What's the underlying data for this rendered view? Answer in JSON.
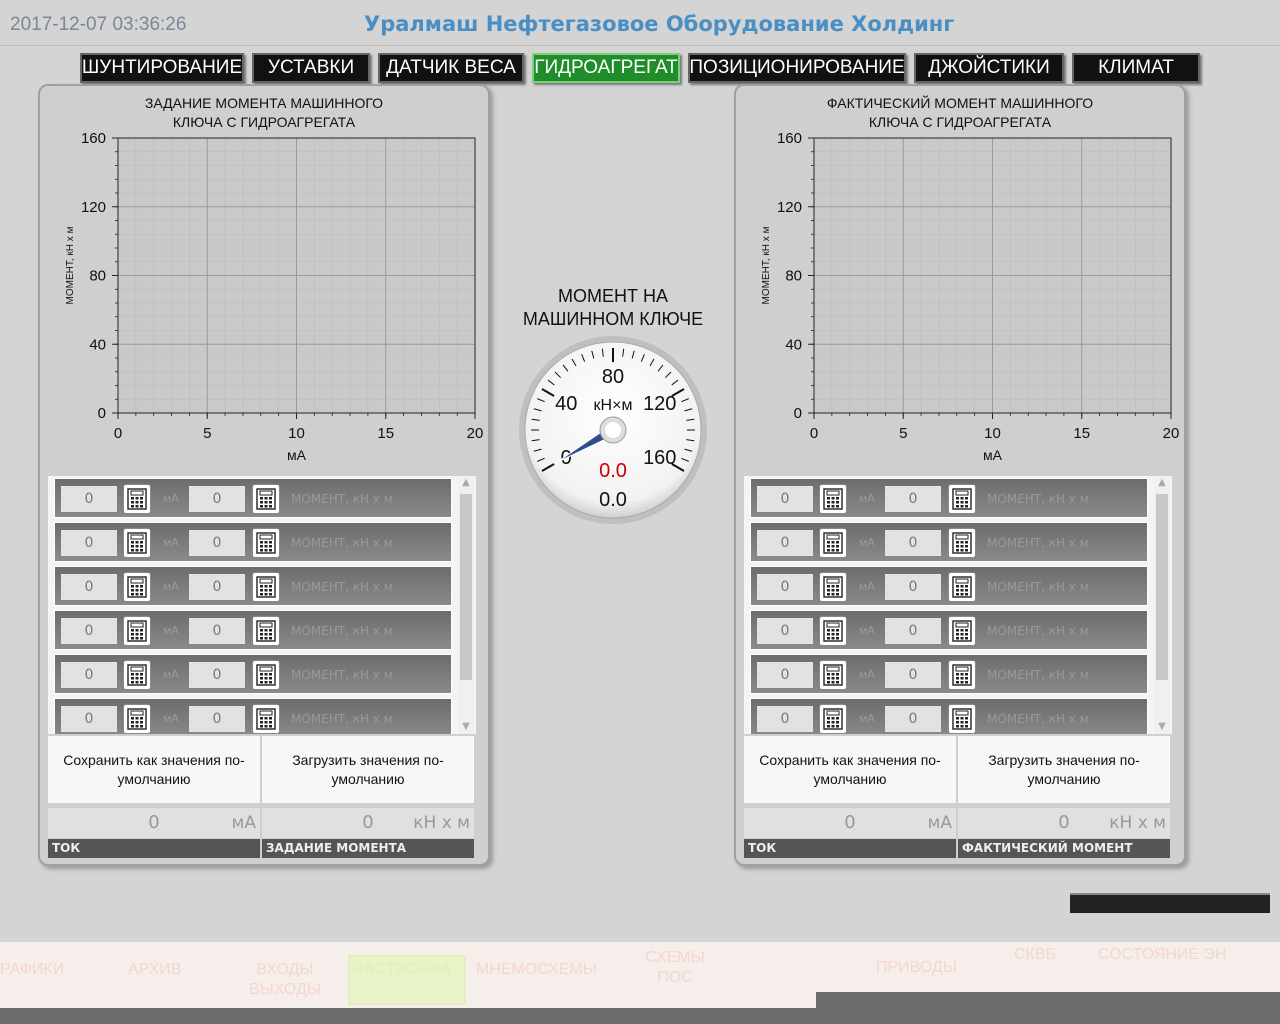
{
  "header": {
    "datetime": "2017-12-07 03:36:26",
    "company": "Уралмаш Нефтегазовое Оборудование Холдинг"
  },
  "tabs": [
    {
      "label": "ШУНТИРОВАНИЕ",
      "active": false
    },
    {
      "label": "УСТАВКИ",
      "active": false
    },
    {
      "label": "ДАТЧИК ВЕСА",
      "active": false
    },
    {
      "label": "ГИДРОАГРЕГАТ",
      "active": true
    },
    {
      "label": "ПОЗИЦИОНИРОВАНИЕ",
      "active": false
    },
    {
      "label": "ДЖОЙСТИКИ",
      "active": false
    },
    {
      "label": "КЛИМАТ",
      "active": false
    }
  ],
  "left_panel": {
    "title_line1": "ЗАДАНИЕ МОМЕНТА МАШИННОГО",
    "title_line2": "КЛЮЧА С ГИДРОАГРЕГАТА",
    "save_button": "Сохранить как значения по-умолчанию",
    "load_button": "Загрузить значения по-умолчанию",
    "readout_current": {
      "value": "0",
      "unit": "мА",
      "label": "ТОК"
    },
    "readout_moment": {
      "value": "0",
      "unit": "кН х м",
      "label": "ЗАДАНИЕ МОМЕНТА"
    }
  },
  "right_panel": {
    "title_line1": "ФАКТИЧЕСКИЙ  МОМЕНТ МАШИННОГО",
    "title_line2": "КЛЮЧА С ГИДРОАГРЕГАТА",
    "save_button": "Сохранить как значения по-умолчанию",
    "load_button": "Загрузить значения по-умолчанию",
    "readout_current": {
      "value": "0",
      "unit": "мА",
      "label": "ТОК"
    },
    "readout_moment": {
      "value": "0",
      "unit": "кН х м",
      "label": "ФАКТИЧЕСКИЙ  МОМЕНТ"
    }
  },
  "table_rows": {
    "unit_ma": "мА",
    "moment_label": "МОМЕНТ, кН х м",
    "rows": [
      {
        "ma": "0",
        "moment": "0"
      },
      {
        "ma": "0",
        "moment": "0"
      },
      {
        "ma": "0",
        "moment": "0"
      },
      {
        "ma": "0",
        "moment": "0"
      },
      {
        "ma": "0",
        "moment": "0"
      },
      {
        "ma": "0",
        "moment": "0"
      }
    ]
  },
  "gauge": {
    "title_line1": "МОМЕНТ НА",
    "title_line2": "МАШИННОМ КЛЮЧЕ",
    "unit": "кН×м",
    "scale_labels": [
      "0",
      "40",
      "80",
      "120",
      "160"
    ],
    "min": 0,
    "max": 160,
    "value": 0,
    "value_red": "0.0",
    "value_black": "0.0"
  },
  "chart_data": [
    {
      "type": "line",
      "title": "ЗАДАНИЕ МОМЕНТА МАШИННОГО КЛЮЧА С ГИДРОАГРЕГАТА",
      "xlabel": "мА",
      "ylabel": "МОМЕНТ, кН х м",
      "xlim": [
        0,
        20
      ],
      "ylim": [
        0,
        160
      ],
      "x_ticks": [
        0,
        5,
        10,
        15,
        20
      ],
      "y_ticks": [
        0,
        40,
        80,
        120,
        160
      ],
      "grid": true,
      "series": []
    },
    {
      "type": "line",
      "title": "ФАКТИЧЕСКИЙ  МОМЕНТ МАШИННОГО КЛЮЧА С ГИДРОАГРЕГАТА",
      "xlabel": "мА",
      "ylabel": "МОМЕНТ, кН х м",
      "xlim": [
        0,
        20
      ],
      "ylim": [
        0,
        160
      ],
      "x_ticks": [
        0,
        5,
        10,
        15,
        20
      ],
      "y_ticks": [
        0,
        40,
        80,
        120,
        160
      ],
      "grid": true,
      "series": []
    }
  ],
  "bottom_nav": [
    {
      "label": "РАФИКИ"
    },
    {
      "label": "АРХИВ"
    },
    {
      "label": "ВХОДЫ ВЫХОДЫ"
    },
    {
      "label": "НАСТРОЙКА",
      "active": true
    },
    {
      "label": "МНЕМОСХЕМЫ"
    },
    {
      "label": "СХЕМЫ ПОС"
    },
    {
      "label": "ПРИВОДЫ"
    },
    {
      "label": "СКВБ"
    },
    {
      "label": "СОСТОЯНИЕ ЭН"
    }
  ],
  "colors": {
    "accent_blue": "#4a8fc4",
    "active_tab": "#1f8d29",
    "gauge_red": "#cc0000"
  }
}
